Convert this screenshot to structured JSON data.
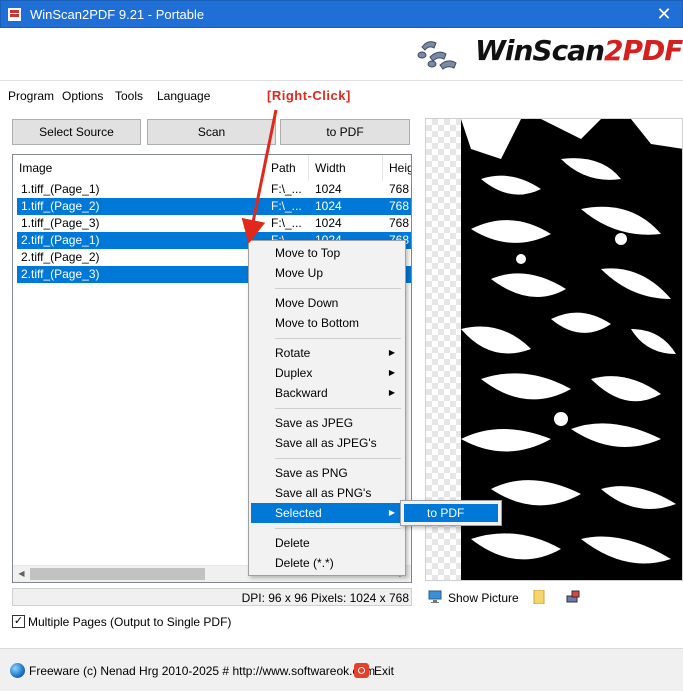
{
  "window": {
    "title": "WinScan2PDF 9.21 - Portable",
    "close_glyph": "✕"
  },
  "logo": {
    "part1": "WinScan",
    "part2": "2",
    "part3": "PDF"
  },
  "menu": {
    "items": [
      "Program",
      "Options",
      "Tools",
      "Language"
    ]
  },
  "annotation": {
    "label": "[Right-Click]",
    "color": "#e0281c"
  },
  "toolbar": {
    "select_source": "Select Source",
    "scan": "Scan",
    "to_pdf": "to PDF"
  },
  "list": {
    "columns": [
      "Image",
      "Path",
      "Width",
      "Heig"
    ],
    "rows": [
      {
        "image": "1.tiff_(Page_1)",
        "path": "F:\\_...",
        "width": "1024",
        "height": "768",
        "selected": false
      },
      {
        "image": "1.tiff_(Page_2)",
        "path": "F:\\_...",
        "width": "1024",
        "height": "768",
        "selected": true
      },
      {
        "image": "1.tiff_(Page_3)",
        "path": "F:\\_...",
        "width": "1024",
        "height": "768",
        "selected": false
      },
      {
        "image": "2.tiff_(Page_1)",
        "path": "F:\\_...",
        "width": "1024",
        "height": "768",
        "selected": true
      },
      {
        "image": "2.tiff_(Page_2)",
        "path": "",
        "width": "",
        "height": "",
        "selected": false
      },
      {
        "image": "2.tiff_(Page_3)",
        "path": "",
        "width": "",
        "height": "",
        "selected": true
      }
    ]
  },
  "status": {
    "dpi_text": "DPI: 96 x 96 Pixels: 1024 x 768"
  },
  "preview": {
    "show_picture": "Show Picture"
  },
  "options": {
    "multiple_pages_label": "Multiple Pages (Output to Single PDF)",
    "multiple_pages_checked": true,
    "check_glyph": "✓"
  },
  "footer": {
    "text": "Freeware (c) Nenad Hrg 2010-2025 # http://www.softwareok.com",
    "exit": "Exit"
  },
  "context_menu": {
    "move_to_top": "Move to Top",
    "move_up": "Move Up",
    "move_down": "Move Down",
    "move_to_bottom": "Move to Bottom",
    "rotate": "Rotate",
    "duplex": "Duplex",
    "backward": "Backward",
    "save_as_jpeg": "Save as JPEG",
    "save_all_as_jpegs": "Save all as JPEG's",
    "save_as_png": "Save as PNG",
    "save_all_as_pngs": "Save all as PNG's",
    "selected": "Selected",
    "delete": "Delete",
    "delete_all": "Delete (*.*)",
    "submenu_arrow": "▶"
  },
  "submenu": {
    "to_pdf": "to PDF"
  },
  "colors": {
    "selection": "#0078d7",
    "titlebar": "#1f6fd6",
    "logo_red": "#d52020"
  }
}
